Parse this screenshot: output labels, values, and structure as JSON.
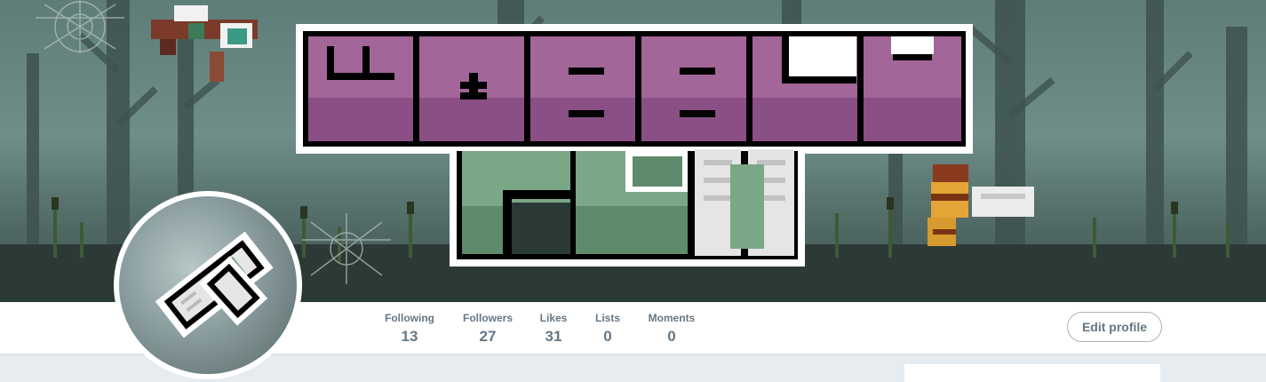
{
  "banner": {
    "logo_text_line1": "WOBBLY",
    "logo_text_line2": "FLY",
    "colors": {
      "sky": "#6f8e89",
      "logo_purple": "#9b5a93",
      "logo_green": "#6e9a7a",
      "outline": "#000000"
    }
  },
  "stats": [
    {
      "label": "Following",
      "value": "13"
    },
    {
      "label": "Followers",
      "value": "27"
    },
    {
      "label": "Likes",
      "value": "31"
    },
    {
      "label": "Lists",
      "value": "0"
    },
    {
      "label": "Moments",
      "value": "0"
    }
  ],
  "actions": {
    "edit_profile_label": "Edit profile"
  },
  "icons": {
    "avatar": "fly-wing-icon",
    "banner_left": "dragonfly-icon",
    "banner_right": "bee-icon"
  }
}
